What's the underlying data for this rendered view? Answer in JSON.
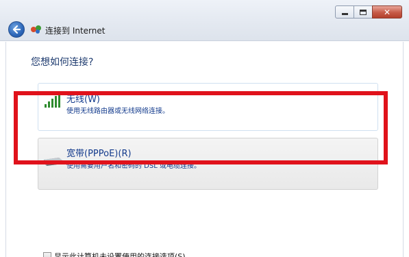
{
  "window": {
    "title": "连接到 Internet"
  },
  "prompt": {
    "question": "您想如何连接?"
  },
  "options": [
    {
      "title": "无线(W)",
      "description": "使用无线路由器或无线网络连接。",
      "icon": "wireless-signal-icon"
    },
    {
      "title": "宽带(PPPoE)(R)",
      "description": "使用需要用户名和密码的 DSL 或电缆连接。",
      "icon": "broadband-modem-icon"
    }
  ],
  "checkbox": {
    "label": "显示此计算机未设置使用的连接选项(S)",
    "checked": false
  },
  "colors": {
    "highlight": "#e0121b",
    "link_text": "#123a8c",
    "heading": "#1e3b6f"
  }
}
